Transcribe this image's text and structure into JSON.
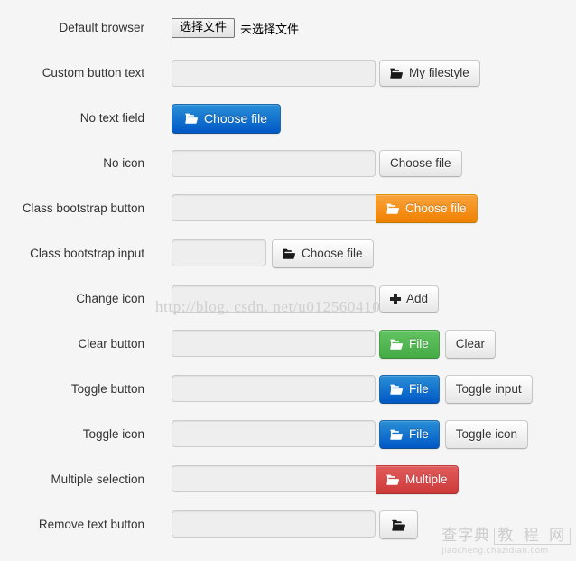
{
  "page": {
    "background_color": "#f5f5f5",
    "text_color": "#333333"
  },
  "watermarks": {
    "url": "http://blog. csdn. net/u012560410",
    "logo_text": "查字典",
    "logo_boxed_text": "教 程 网",
    "logo_domain": "jiaocheng.chazidian.com"
  },
  "icons": {
    "folder": "folder-open-icon",
    "plus": "plus-icon"
  },
  "colors": {
    "primary": "#0058c6",
    "warning": "#f08100",
    "success": "#45ab45",
    "danger": "#ce3a3a",
    "default": "#e6e6e6",
    "input_bg": "#eeeeee",
    "input_border": "#cccccc"
  },
  "rows": [
    {
      "label": "Default browser",
      "type": "native",
      "native_button": "选择文件",
      "native_status": "未选择文件"
    },
    {
      "label": "Custom button text",
      "type": "input-button",
      "input_value": "",
      "button_label": "My filestyle",
      "button_style": "default",
      "has_icon": true
    },
    {
      "label": "No text field",
      "type": "button-only",
      "button_label": "Choose file",
      "button_style": "primary",
      "has_icon": true
    },
    {
      "label": "No icon",
      "type": "input-button",
      "input_value": "",
      "button_label": "Choose file",
      "button_style": "default",
      "has_icon": false
    },
    {
      "label": "Class bootstrap button",
      "type": "input-button-joined",
      "input_value": "",
      "button_label": "Choose file",
      "button_style": "warning",
      "has_icon": true
    },
    {
      "label": "Class bootstrap input",
      "type": "input-short-button",
      "input_value": "",
      "button_label": "Choose file",
      "button_style": "default",
      "has_icon": true
    },
    {
      "label": "Change icon",
      "type": "input-button",
      "input_value": "",
      "button_label": "Add",
      "button_style": "default",
      "icon": "plus"
    },
    {
      "label": "Clear button",
      "type": "input-button-extra",
      "input_value": "",
      "button_label": "File",
      "button_style": "success",
      "has_icon": true,
      "extra_label": "Clear"
    },
    {
      "label": "Toggle button",
      "type": "input-button-extra",
      "input_value": "",
      "button_label": "File",
      "button_style": "primary",
      "has_icon": true,
      "extra_label": "Toggle input"
    },
    {
      "label": "Toggle icon",
      "type": "input-button-extra",
      "input_value": "",
      "button_label": "File",
      "button_style": "primary",
      "has_icon": true,
      "extra_label": "Toggle icon"
    },
    {
      "label": "Multiple selection",
      "type": "input-button-joined",
      "input_value": "",
      "button_label": "Multiple",
      "button_style": "danger",
      "has_icon": true
    },
    {
      "label": "Remove text button",
      "type": "input-icon-only",
      "input_value": "",
      "button_label": "",
      "button_style": "default",
      "has_icon": true
    }
  ]
}
